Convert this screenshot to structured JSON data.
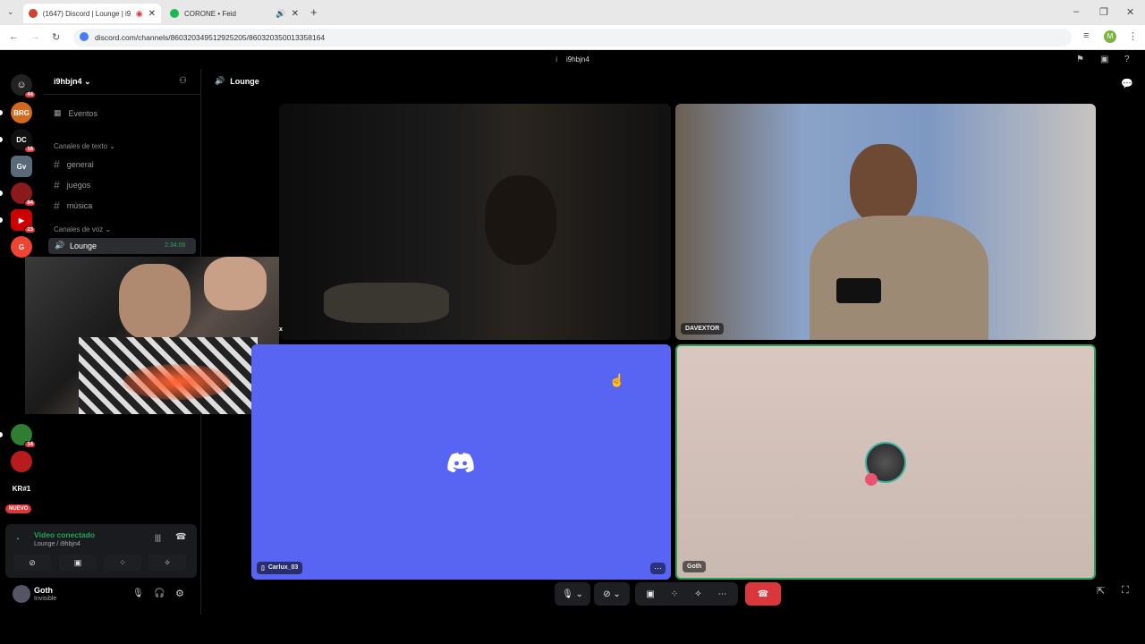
{
  "browser": {
    "tabs": [
      {
        "title": "(1647) Discord | Lounge | i9",
        "active": true
      },
      {
        "title": "CORONE • Feid",
        "active": false
      }
    ],
    "url": "discord.com/channels/860320349512925205/860320350013358164"
  },
  "discord": {
    "server_name": "i9hbjn4",
    "title_bar": "i9hbjn4",
    "servers": [
      {
        "name": "dm-icon",
        "badge": "44"
      },
      {
        "name": "BRG",
        "badge": ""
      },
      {
        "name": "DC",
        "badge": "16"
      },
      {
        "name": "Gv",
        "badge": ""
      },
      {
        "name": "red",
        "badge": "84"
      },
      {
        "name": "yt",
        "badge": "23"
      },
      {
        "name": "G",
        "badge": ""
      },
      {
        "name": "green",
        "badge": "14"
      },
      {
        "name": "knuckles",
        "badge": ""
      },
      {
        "name": "KR#1",
        "badge": ""
      }
    ],
    "new_label": "NUEVO",
    "events_label": "Eventos",
    "text_category": "Canales de texto",
    "text_channels": [
      "general",
      "juegos",
      "música"
    ],
    "voice_category": "Canales de voz",
    "voice_channel": {
      "name": "Lounge",
      "timer": "2:34:06"
    },
    "voice_status": {
      "title": "Vídeo conectado",
      "subtitle": "Lounge / i9hbjn4"
    },
    "user": {
      "name": "Goth",
      "status": "Invisible"
    },
    "call_header": "Lounge",
    "participants": [
      {
        "name": "x"
      },
      {
        "name": "DAVEXTOR"
      },
      {
        "name": "Carlux_03"
      },
      {
        "name": "Goth"
      }
    ]
  },
  "colors": {
    "blurple": "#5865f2",
    "green": "#23a55a",
    "danger": "#da373c",
    "goth_bg": "#d9c7c0"
  }
}
